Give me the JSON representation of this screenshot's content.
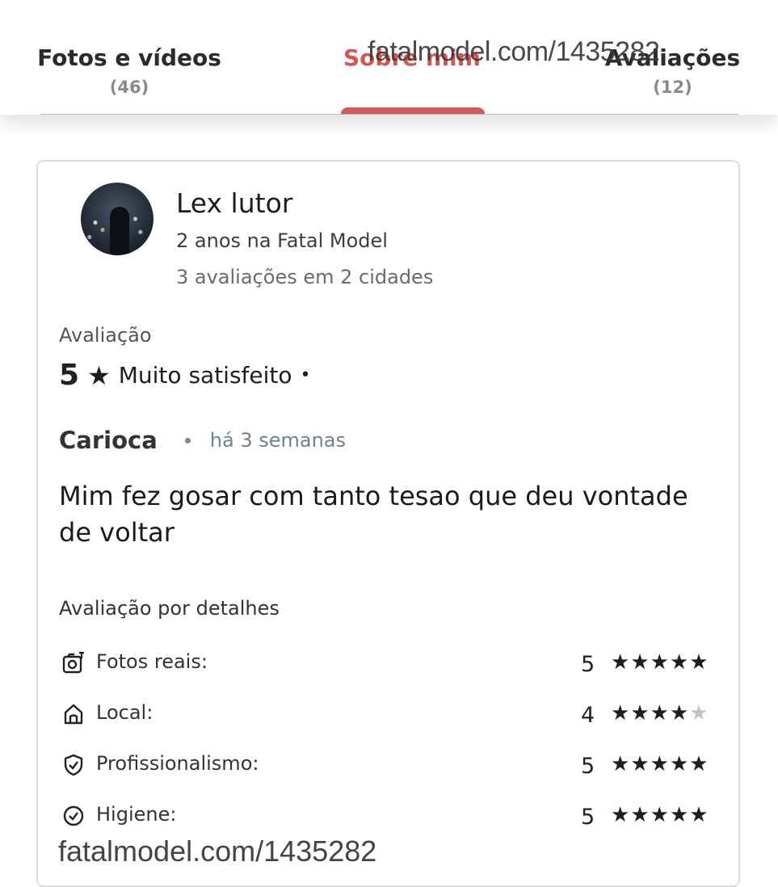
{
  "tabs": [
    {
      "label": "Fotos e vídeos",
      "count": "(46)"
    },
    {
      "label": "Sobre mim",
      "count": ""
    },
    {
      "label": "Avaliações",
      "count": "(12)"
    }
  ],
  "active_tab_color": "#d9534f",
  "watermark": "fatalmodel.com/1435282",
  "review": {
    "reviewer_name": "Lex lutor",
    "tenure": "2 anos na Fatal Model",
    "reviews_summary": "3 avaliações em 2 cidades",
    "rating_label": "Avaliação",
    "rating_value": "5",
    "rating_star": "★",
    "rating_text": "Muito satisfeito",
    "rating_dot": "•",
    "city": "Carioca",
    "time_ago": "há 3 semanas",
    "comment": "Mim fez gosar com tanto tesao que deu vontade de voltar",
    "details_title": "Avaliação por detalhes",
    "details": [
      {
        "icon": "camera-icon",
        "label": "Fotos reais:",
        "score": "5",
        "stars": 5
      },
      {
        "icon": "home-icon",
        "label": "Local:",
        "score": "4",
        "stars": 4
      },
      {
        "icon": "shield-check-icon",
        "label": "Profissionalismo:",
        "score": "5",
        "stars": 5
      },
      {
        "icon": "check-circle-icon",
        "label": "Higiene:",
        "score": "5",
        "stars": 5
      }
    ]
  }
}
